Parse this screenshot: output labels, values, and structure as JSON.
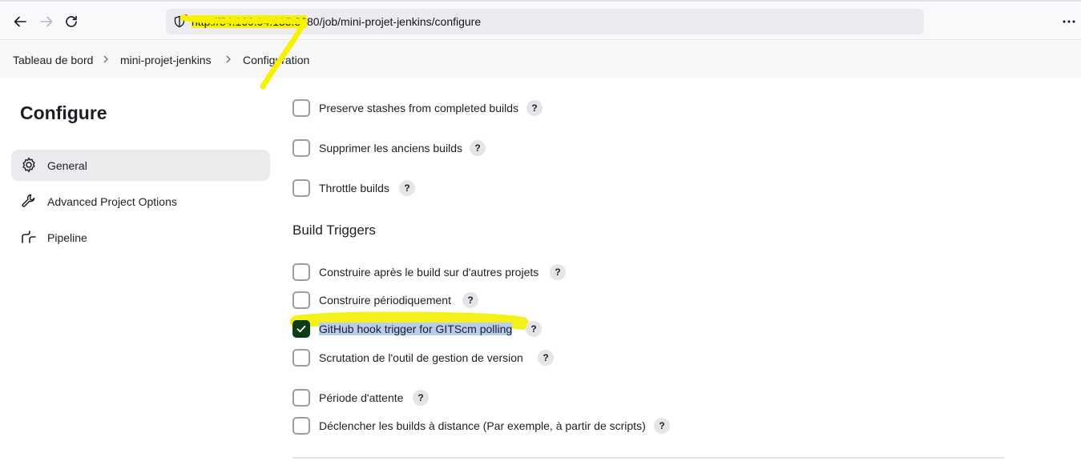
{
  "browser": {
    "url_highlighted": "http://54.160.94.135:80",
    "url_rest": "80/job/mini-projet-jenkins/configure",
    "icons": [
      "back-arrow-icon",
      "forward-arrow-icon",
      "reload-icon",
      "shield-icon",
      "more-menu-icon"
    ]
  },
  "breadcrumb": {
    "items": [
      "Tableau de bord",
      "mini-projet-jenkins",
      "Configuration"
    ]
  },
  "sidebar": {
    "title": "Configure",
    "items": [
      {
        "label": "General",
        "icon": "gear-icon",
        "active": true
      },
      {
        "label": "Advanced Project Options",
        "icon": "wrench-icon",
        "active": false
      },
      {
        "label": "Pipeline",
        "icon": "pipeline-icon",
        "active": false
      }
    ]
  },
  "main": {
    "general_options": [
      {
        "label": "Preserve stashes from completed builds",
        "checked": false
      },
      {
        "label": "Supprimer les anciens builds",
        "checked": false
      },
      {
        "label": "Throttle builds",
        "checked": false
      }
    ],
    "build_triggers_title": "Build Triggers",
    "build_triggers": [
      {
        "label": "Construire après le build sur d'autres projets",
        "checked": false
      },
      {
        "label": "Construire périodiquement",
        "checked": false
      },
      {
        "label": "GitHub hook trigger for GITScm polling",
        "checked": true
      },
      {
        "label": "Scrutation de l'outil de gestion de version",
        "checked": false
      },
      {
        "label": "Période d'attente",
        "checked": false
      },
      {
        "label": "Déclencher les builds à distance (Par exemple, à partir de scripts)",
        "checked": false
      }
    ],
    "help_label": "?"
  },
  "colors": {
    "checked_box": "#0b3d17",
    "annotation_yellow": "#f7f200",
    "selection_blue": "#b9cdf0"
  }
}
